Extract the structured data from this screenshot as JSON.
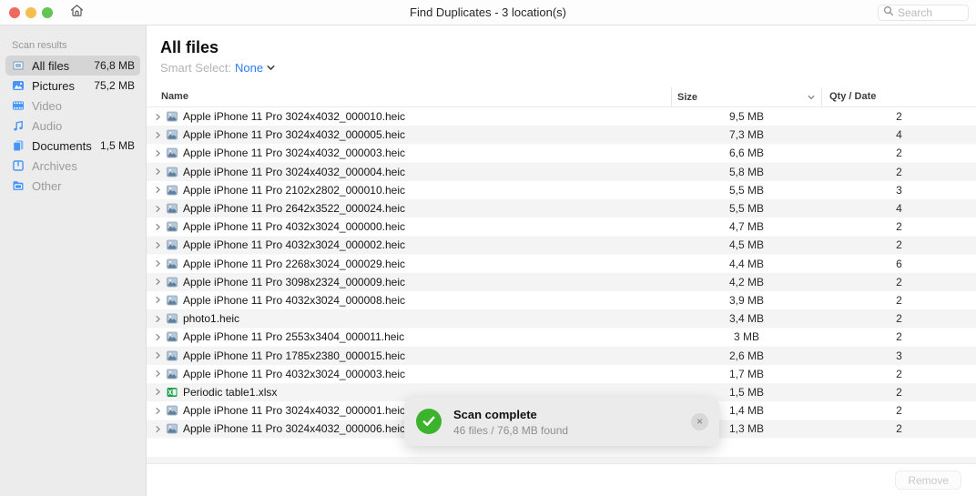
{
  "window": {
    "title": "Find Duplicates - 3 location(s)",
    "search_placeholder": "Search"
  },
  "sidebar": {
    "header": "Scan results",
    "items": [
      {
        "label": "All files",
        "size": "76,8 MB",
        "icon": "all-files-icon",
        "selected": true,
        "dimmed": false
      },
      {
        "label": "Pictures",
        "size": "75,2 MB",
        "icon": "pictures-icon",
        "selected": false,
        "dimmed": false
      },
      {
        "label": "Video",
        "size": "",
        "icon": "video-icon",
        "selected": false,
        "dimmed": true
      },
      {
        "label": "Audio",
        "size": "",
        "icon": "audio-icon",
        "selected": false,
        "dimmed": true
      },
      {
        "label": "Documents",
        "size": "1,5 MB",
        "icon": "documents-icon",
        "selected": false,
        "dimmed": false
      },
      {
        "label": "Archives",
        "size": "",
        "icon": "archives-icon",
        "selected": false,
        "dimmed": true
      },
      {
        "label": "Other",
        "size": "",
        "icon": "other-icon",
        "selected": false,
        "dimmed": true
      }
    ]
  },
  "main": {
    "title": "All files",
    "smart_select": {
      "label": "Smart Select:",
      "value": "None"
    },
    "table": {
      "columns": {
        "name": "Name",
        "size": "Size",
        "qty": "Qty / Date"
      },
      "rows": [
        {
          "name": "Apple iPhone 11 Pro 3024x4032_000010.heic",
          "size": "9,5 MB",
          "qty": "2",
          "icon": "image-file-icon"
        },
        {
          "name": "Apple iPhone 11 Pro 3024x4032_000005.heic",
          "size": "7,3 MB",
          "qty": "4",
          "icon": "image-file-icon"
        },
        {
          "name": "Apple iPhone 11 Pro 3024x4032_000003.heic",
          "size": "6,6 MB",
          "qty": "2",
          "icon": "image-file-icon"
        },
        {
          "name": "Apple iPhone 11 Pro 3024x4032_000004.heic",
          "size": "5,8 MB",
          "qty": "2",
          "icon": "image-file-icon"
        },
        {
          "name": "Apple iPhone 11 Pro 2102x2802_000010.heic",
          "size": "5,5 MB",
          "qty": "3",
          "icon": "image-file-icon"
        },
        {
          "name": "Apple iPhone 11 Pro 2642x3522_000024.heic",
          "size": "5,5 MB",
          "qty": "4",
          "icon": "image-file-icon"
        },
        {
          "name": "Apple iPhone 11 Pro 4032x3024_000000.heic",
          "size": "4,7 MB",
          "qty": "2",
          "icon": "image-file-icon"
        },
        {
          "name": "Apple iPhone 11 Pro 4032x3024_000002.heic",
          "size": "4,5 MB",
          "qty": "2",
          "icon": "image-file-icon"
        },
        {
          "name": "Apple iPhone 11 Pro 2268x3024_000029.heic",
          "size": "4,4 MB",
          "qty": "6",
          "icon": "image-file-icon"
        },
        {
          "name": "Apple iPhone 11 Pro 3098x2324_000009.heic",
          "size": "4,2 MB",
          "qty": "2",
          "icon": "image-file-icon"
        },
        {
          "name": "Apple iPhone 11 Pro 4032x3024_000008.heic",
          "size": "3,9 MB",
          "qty": "2",
          "icon": "image-file-icon"
        },
        {
          "name": "photo1.heic",
          "size": "3,4 MB",
          "qty": "2",
          "icon": "image-file-icon"
        },
        {
          "name": "Apple iPhone 11 Pro 2553x3404_000011.heic",
          "size": "3 MB",
          "qty": "2",
          "icon": "image-file-icon"
        },
        {
          "name": "Apple iPhone 11 Pro 1785x2380_000015.heic",
          "size": "2,6 MB",
          "qty": "3",
          "icon": "image-file-icon"
        },
        {
          "name": "Apple iPhone 11 Pro 4032x3024_000003.heic",
          "size": "1,7 MB",
          "qty": "2",
          "icon": "image-file-icon"
        },
        {
          "name": "Periodic table1.xlsx",
          "size": "1,5 MB",
          "qty": "2",
          "icon": "excel-file-icon"
        },
        {
          "name": "Apple iPhone 11 Pro 3024x4032_000001.heic",
          "size": "1,4 MB",
          "qty": "2",
          "icon": "image-file-icon"
        },
        {
          "name": "Apple iPhone 11 Pro 3024x4032_000006.heic",
          "size": "1,3 MB",
          "qty": "2",
          "icon": "image-file-icon"
        }
      ]
    },
    "footer": {
      "remove_label": "Remove"
    }
  },
  "toast": {
    "title": "Scan complete",
    "subtitle": "46 files / 76,8 MB found",
    "close_label": "×"
  },
  "colors": {
    "accent_blue": "#2e7cf6",
    "success_green": "#3cb32c",
    "sidebar_bg": "#ececec",
    "selected_item_bg": "#d5d5d5",
    "row_stripe": "#f4f4f4",
    "traffic_red": "#ee6a5f",
    "traffic_yellow": "#f5bf4f",
    "traffic_green": "#62c554"
  }
}
